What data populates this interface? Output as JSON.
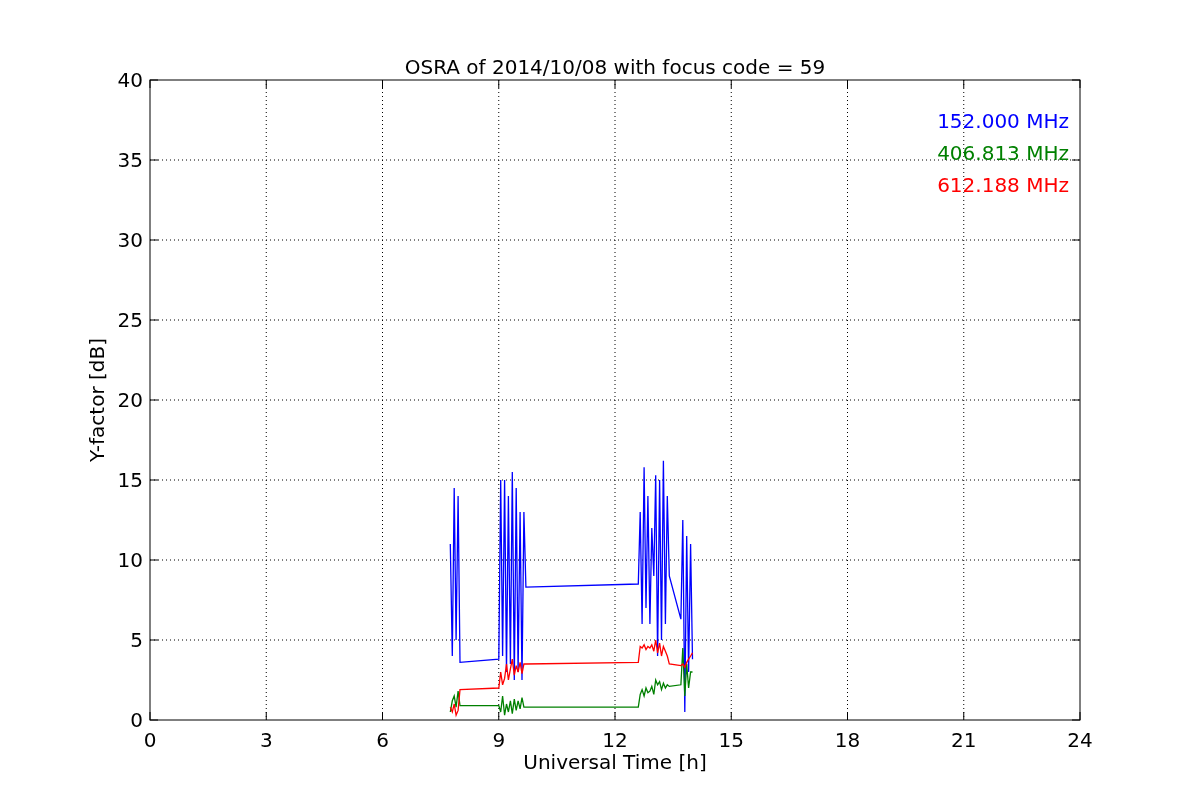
{
  "figure": {
    "chart_data": {
      "type": "line",
      "title": "OSRA of 2014/10/08 with focus code = 59",
      "xlabel": "Universal Time [h]",
      "ylabel": "Y-factor [dB]",
      "xlim": [
        0,
        24
      ],
      "ylim": [
        0,
        40
      ],
      "xticks": [
        0,
        3,
        6,
        9,
        12,
        15,
        18,
        21,
        24
      ],
      "yticks": [
        0,
        5,
        10,
        15,
        20,
        25,
        30,
        35,
        40
      ],
      "grid": true,
      "x": [
        7.75,
        7.8,
        7.85,
        7.9,
        7.95,
        8.0,
        9.0,
        9.05,
        9.1,
        9.15,
        9.2,
        9.25,
        9.3,
        9.35,
        9.4,
        9.45,
        9.5,
        9.55,
        9.6,
        9.65,
        9.7,
        12.6,
        12.65,
        12.7,
        12.75,
        12.8,
        12.85,
        12.9,
        12.95,
        13.0,
        13.05,
        13.1,
        13.15,
        13.2,
        13.25,
        13.3,
        13.35,
        13.4,
        13.7,
        13.75,
        13.8,
        13.85,
        13.9,
        13.95,
        14.0
      ],
      "series": [
        {
          "name": "152.000 MHz",
          "color": "#0000ff",
          "values": [
            11,
            4,
            14.5,
            5,
            14,
            3.6,
            3.8,
            15,
            4,
            15,
            3,
            14,
            3.5,
            15.5,
            2.5,
            14.5,
            3,
            13,
            2.5,
            13,
            8.3,
            8.5,
            13,
            6,
            15.8,
            7,
            14,
            6,
            12,
            9,
            15.3,
            4,
            15,
            5,
            16.2,
            6,
            14,
            9,
            6.3,
            12.5,
            0.5,
            11.5,
            3,
            11,
            3.8
          ]
        },
        {
          "name": "406.813 MHz",
          "color": "#008000",
          "values": [
            0.5,
            1.2,
            1.5,
            0.8,
            1.8,
            0.9,
            0.9,
            0.5,
            1.5,
            0.3,
            1,
            0.5,
            1.2,
            0.4,
            1.3,
            0.6,
            1.2,
            0.7,
            1.4,
            0.8,
            0.8,
            0.8,
            1.6,
            1.9,
            1.5,
            2.0,
            1.7,
            1.8,
            2.1,
            1.6,
            2.5,
            2.2,
            2.4,
            1.9,
            2.3,
            2.0,
            2.2,
            2.1,
            2.2,
            4.5,
            1.5,
            3.5,
            2.0,
            3.0,
            3.0
          ]
        },
        {
          "name": "612.188 MHz",
          "color": "#ff0000",
          "values": [
            0.8,
            0.5,
            1.0,
            0.3,
            0.6,
            1.9,
            2.0,
            3,
            2.2,
            2.6,
            3.5,
            2.5,
            3.2,
            3.8,
            2.8,
            3.4,
            3.0,
            3.6,
            2.9,
            3.5,
            3.5,
            3.6,
            4.6,
            4.5,
            4.7,
            4.4,
            4.6,
            4.5,
            4.7,
            4.3,
            5.0,
            4.2,
            4.8,
            4.0,
            4.6,
            4.3,
            4.0,
            3.5,
            3.4,
            3.5,
            3.3,
            3.6,
            3.8,
            4.0,
            4.2
          ]
        }
      ]
    }
  }
}
